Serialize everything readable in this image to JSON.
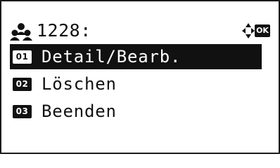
{
  "header": {
    "icon": "users-icon",
    "title": "1228:",
    "nav_icon": "four-way-arrows-icon",
    "ok_label": "OK"
  },
  "menu": {
    "items": [
      {
        "number": "01",
        "label": "Detail/Bearb.",
        "selected": true
      },
      {
        "number": "02",
        "label": "Löschen",
        "selected": false
      },
      {
        "number": "03",
        "label": "Beenden",
        "selected": false
      }
    ]
  },
  "colors": {
    "foreground": "#111111",
    "background": "#ffffff"
  }
}
